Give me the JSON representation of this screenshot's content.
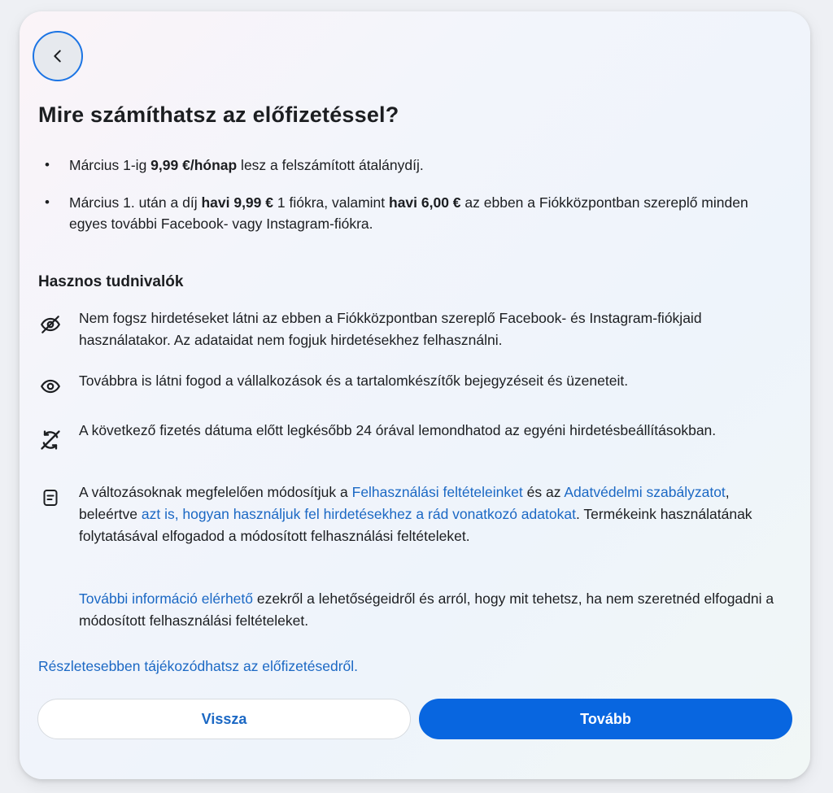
{
  "header": {
    "back_icon": "chevron-left-icon",
    "title": "Mire számíthatsz az előfizetéssel?"
  },
  "pricing": {
    "item1": {
      "pre": "Március 1-ig ",
      "bold": "9,99 €/hónap",
      "post": " lesz a felszámított átalánydíj."
    },
    "item2": {
      "pre": "Március 1. után a díj ",
      "bold1": "havi 9,99 €",
      "mid": " 1 fiókra, valamint ",
      "bold2": "havi 6,00 €",
      "post": " az ebben a Fiókközpontban szereplő minden egyes további Facebook- vagy Instagram-fiókra."
    }
  },
  "info": {
    "heading": "Hasznos tudnivalók",
    "no_ads": {
      "icon": "eye-off-icon",
      "text": "Nem fogsz hirdetéseket látni az ebben a Fiókközpontban szereplő Facebook- és Instagram-fiókjaid használatakor. Az adataidat nem fogjuk hirdetésekhez felhasználni."
    },
    "content": {
      "icon": "eye-icon",
      "text": "Továbbra is látni fogod a vállalkozások és a tartalomkészítők bejegyzéseit és üzeneteit."
    },
    "cancel": {
      "icon": "cancel-subscription-icon",
      "text": "A következő fizetés dátuma előtt legkésőbb 24 órával lemondhatod az egyéni hirdetésbeállításokban."
    },
    "terms": {
      "icon": "document-icon",
      "t1": "A változásoknak megfelelően módosítjuk a ",
      "link1": "Felhasználási feltételeinket",
      "t2": " és az ",
      "link2": "Adatvédelmi szabályzatot",
      "t3": ", beleértve ",
      "link3": "azt is, hogyan használjuk fel hirdetésekhez a rád vonatkozó adatokat",
      "t4": ". Termékeink használatának folytatásával elfogadod a módosított felhasználási feltételeket."
    },
    "more": {
      "link": "További információ elérhető",
      "text": " ezekről a lehetőségeidről és arról, hogy mit tehetsz, ha nem szeretnéd elfogadni a módosított felhasználási feltételeket."
    }
  },
  "details_link": "Részletesebben tájékozódhatsz az előfizetésedről.",
  "buttons": {
    "back": "Vissza",
    "next": "Tovább"
  },
  "colors": {
    "primary": "#0866e0",
    "link": "#1b68c4",
    "focus_ring": "#1b74e4",
    "text": "#1c1e21"
  }
}
